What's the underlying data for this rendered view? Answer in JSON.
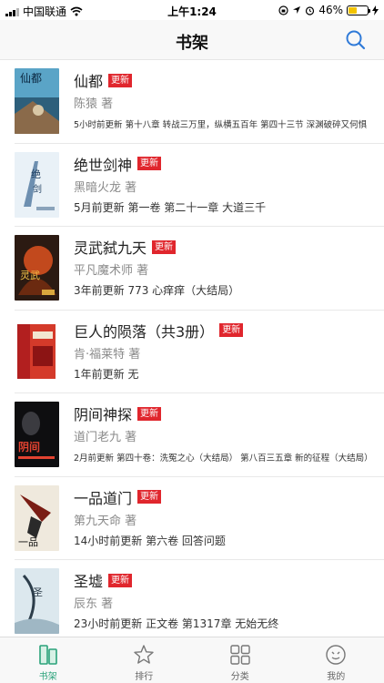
{
  "status_bar": {
    "carrier": "中国联通",
    "time": "上午1:24",
    "battery": "46%",
    "battery_level": 0.46
  },
  "nav": {
    "title": "书架",
    "search_icon": "search-icon"
  },
  "books": [
    {
      "title": "仙都",
      "badge": "更新",
      "author": "陈猿 著",
      "update": "5小时前更新  第十八章 转战三万里，纵横五百年 第四十三节 深渊破碎又何惧"
    },
    {
      "title": "绝世剑神",
      "badge": "更新",
      "author": "黑暗火龙 著",
      "update": "5月前更新  第一卷 第二十一章 大道三千"
    },
    {
      "title": "灵武弑九天",
      "badge": "更新",
      "author": "平凡魔术师 著",
      "update": "3年前更新  773 心痒痒（大结局）"
    },
    {
      "title": "巨人的陨落（共3册）",
      "badge": "更新",
      "author": "肯·福莱特 著",
      "update": "1年前更新  无"
    },
    {
      "title": "阴间神探",
      "badge": "更新",
      "author": "道门老九 著",
      "update": "2月前更新  第四十卷：洗冤之心（大结局）  第八百三五章 新的征程（大结局）"
    },
    {
      "title": "一品道门",
      "badge": "更新",
      "author": "第九天命 著",
      "update": "14小时前更新  第六卷 回答问题"
    },
    {
      "title": "圣墟",
      "badge": "更新",
      "author": "辰东 著",
      "update": "23小时前更新  正文卷 第1317章 无始无终"
    }
  ],
  "tabs": [
    {
      "label": "书架",
      "icon": "bookshelf-icon",
      "active": true
    },
    {
      "label": "排行",
      "icon": "star-icon",
      "active": false
    },
    {
      "label": "分类",
      "icon": "category-grid-icon",
      "active": false
    },
    {
      "label": "我的",
      "icon": "profile-face-icon",
      "active": false
    }
  ],
  "colors": {
    "accent": "#2aa27a",
    "badge": "#e0262d",
    "search": "#2f7ad8"
  }
}
